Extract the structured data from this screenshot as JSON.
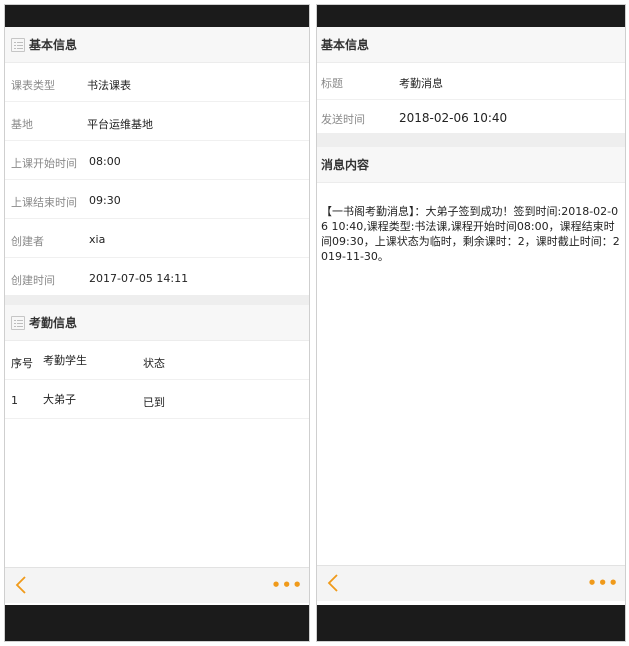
{
  "left": {
    "basic_info_title": "基本信息",
    "fields": [
      {
        "label": "课表类型",
        "value": "书法课表"
      },
      {
        "label": "基地",
        "value": "平台运维基地"
      },
      {
        "label": "上课开始时间",
        "value": "08:00"
      },
      {
        "label": "上课结束时间",
        "value": "09:30"
      },
      {
        "label": "创建者",
        "value": "xia"
      },
      {
        "label": "创建时间",
        "value": "2017-07-05 14:11"
      }
    ],
    "attendance_title": "考勤信息",
    "table": {
      "headers": [
        "序号",
        "考勤学生",
        "状态"
      ],
      "rows": [
        [
          "1",
          "大弟子",
          "已到"
        ]
      ]
    },
    "more_label": "•••"
  },
  "right": {
    "basic_info_title": "基本信息",
    "fields": [
      {
        "label": "标题",
        "value": "考勤消息"
      },
      {
        "label": "发送时间",
        "value": "2018-02-06 10:40"
      }
    ],
    "content_title": "消息内容",
    "message": "【一书阁考勤消息】：大弟子签到成功！签到时间:2018-02-06 10:40,课程类型:书法课,课程开始时间08:00，课程结束时间09:30，上课状态为临时，剩余课时：2，课时截止时间：2019-11-30。",
    "more_label": "•••"
  },
  "colors": {
    "accent": "#f09a1a",
    "bar": "#1b1b1b",
    "section_bg": "#f7f7f7",
    "label": "#8a8a8a"
  }
}
